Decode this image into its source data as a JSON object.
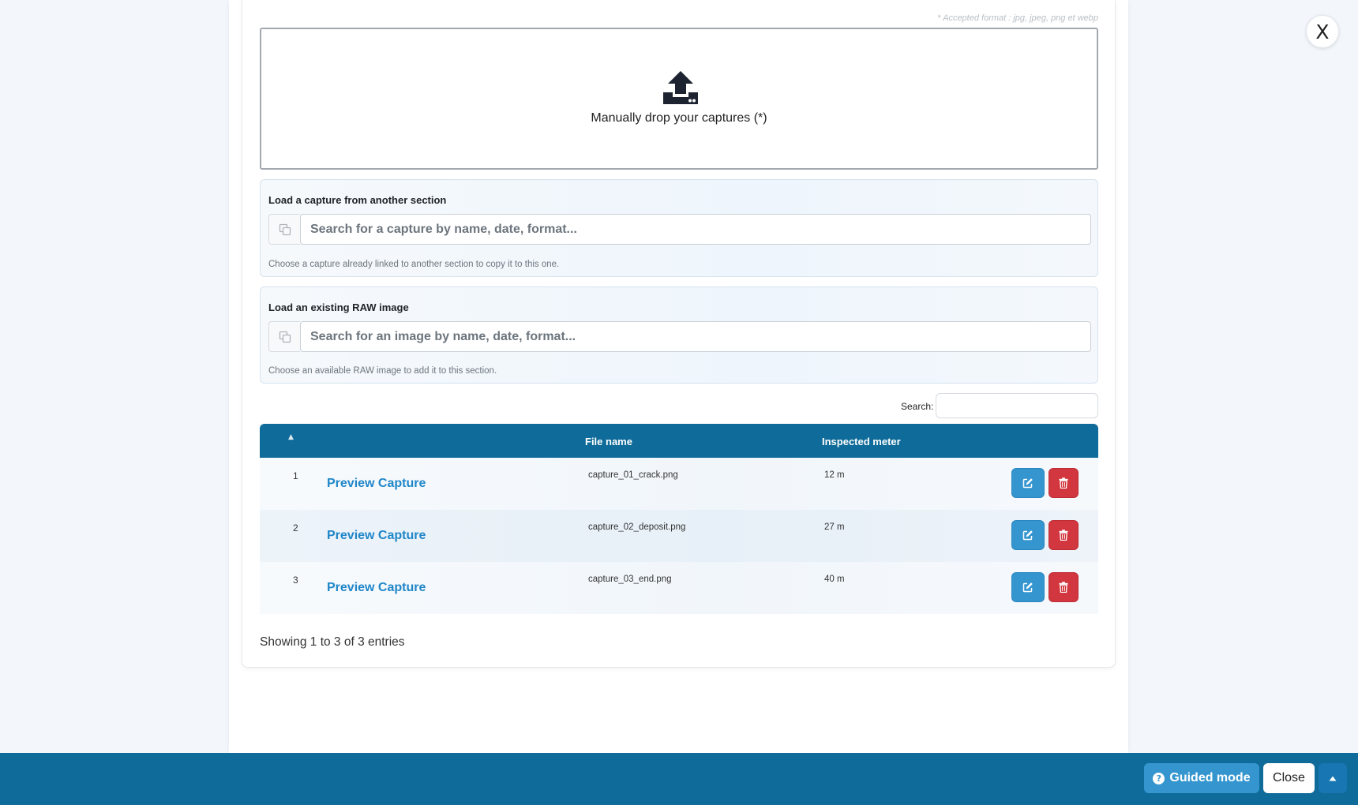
{
  "upload": {
    "accepted_formats": "* Accepted format : jpg, jpeg, png et webp",
    "drop_label": "Manually drop your captures (*)"
  },
  "load_capture": {
    "title": "Load a capture from another section",
    "placeholder": "Search for a capture by name, date, format...",
    "help": "Choose a capture already linked to another section to copy it to this one."
  },
  "load_raw": {
    "title": "Load an existing RAW image",
    "placeholder": "Search for an image by name, date, format...",
    "help": "Choose an available RAW image to add it to this section."
  },
  "table": {
    "search_label": "Search:",
    "search_value": "",
    "headers": {
      "index": "",
      "file_name": "File name",
      "inspected_meter": "Inspected meter"
    },
    "rows": [
      {
        "index": "1",
        "preview": "Preview Capture",
        "file_name": "capture_01_crack.png",
        "meter": "12 m"
      },
      {
        "index": "2",
        "preview": "Preview Capture",
        "file_name": "capture_02_deposit.png",
        "meter": "27 m"
      },
      {
        "index": "3",
        "preview": "Preview Capture",
        "file_name": "capture_03_end.png",
        "meter": "40 m"
      }
    ],
    "info": "Showing 1 to 3 of 3 entries"
  },
  "modal": {
    "close_glyph": "X"
  },
  "footer": {
    "guided_label": "Guided mode",
    "close_label": "Close"
  },
  "icons": {
    "upload": "upload-tray-icon",
    "copy": "copy-icon",
    "edit": "edit-icon",
    "delete": "trash-icon",
    "help": "question-circle-icon",
    "caret": "caret-up-icon"
  },
  "colors": {
    "primary": "#0f6b99",
    "edit": "#3596cf",
    "danger": "#d2373f",
    "link": "#1f86c8"
  }
}
